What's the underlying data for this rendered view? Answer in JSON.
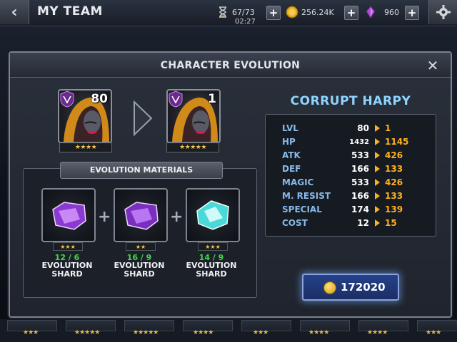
{
  "header": {
    "title": "MY TEAM",
    "energy": "67/73",
    "energy_timer": "02:27",
    "gold": "256.24K",
    "crystals": "960"
  },
  "modal": {
    "title": "CHARACTER EVOLUTION",
    "current": {
      "level": "80",
      "stars": "★★★★"
    },
    "next": {
      "level": "1",
      "stars": "★★★★★"
    },
    "materials_header": "EVOLUTION MATERIALS",
    "materials": [
      {
        "count": "12 / 6",
        "name": "EVOLUTION SHARD",
        "stars": "★★★"
      },
      {
        "count": "16 / 9",
        "name": "EVOLUTION SHARD",
        "stars": "★★"
      },
      {
        "count": "14 / 9",
        "name": "EVOLUTION SHARD",
        "stars": "★★★"
      }
    ],
    "character_name": "CORRUPT HARPY",
    "stats": [
      {
        "label": "LVL",
        "current": "80",
        "new": "1"
      },
      {
        "label": "HP",
        "current": "1432",
        "new": "1145"
      },
      {
        "label": "ATK",
        "current": "533",
        "new": "426"
      },
      {
        "label": "DEF",
        "current": "166",
        "new": "133"
      },
      {
        "label": "MAGIC",
        "current": "533",
        "new": "426"
      },
      {
        "label": "M. RESIST",
        "current": "166",
        "new": "133"
      },
      {
        "label": "SPECIAL",
        "current": "174",
        "new": "139"
      },
      {
        "label": "COST",
        "current": "12",
        "new": "15"
      }
    ],
    "cost": "172020"
  },
  "background_team_stars": [
    "★★★",
    "★★★★★",
    "★★★★★",
    "★★★★",
    "★★★",
    "★★★★",
    "★★★★",
    "★★★"
  ],
  "colors": {
    "stat_label": "#86b9ea",
    "stat_new": "#ffb020",
    "material_count": "#41d84d",
    "character_name": "#8fd4ff"
  },
  "icons": {
    "back": "chevron-left-icon",
    "energy": "hourglass-icon",
    "gold": "coin-icon",
    "crystals": "crystal-icon",
    "settings": "gear-icon",
    "close": "close-icon",
    "class": "assassin-class-icon"
  }
}
